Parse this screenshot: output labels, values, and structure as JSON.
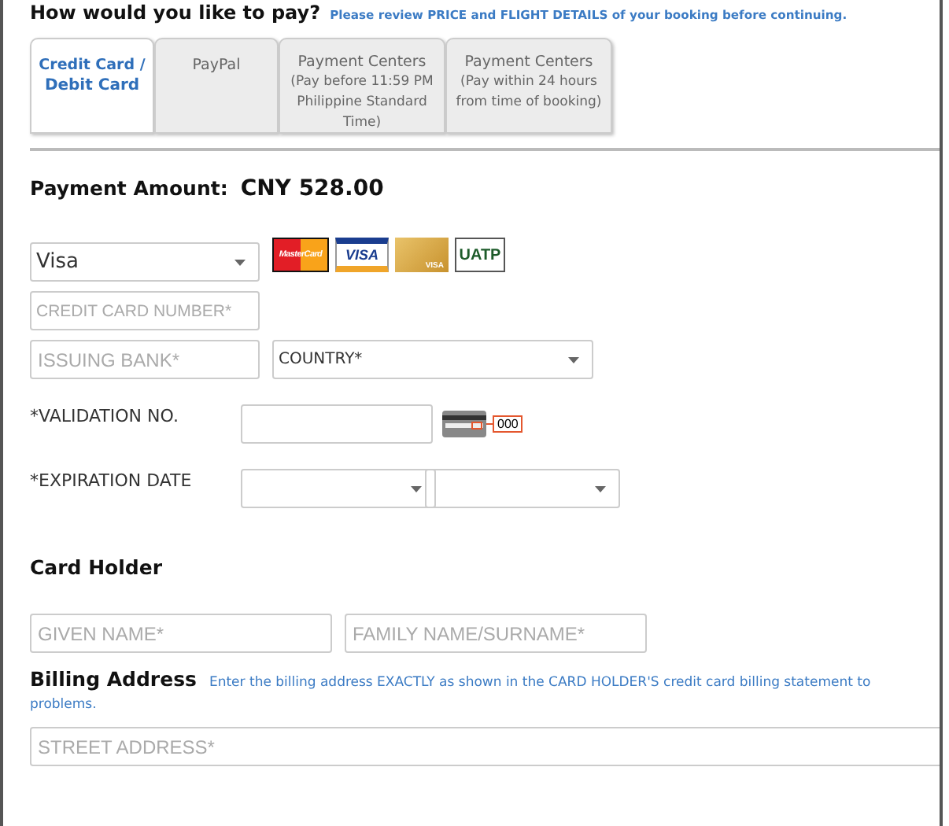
{
  "header": {
    "title": "How would you like to pay?",
    "note": "Please review PRICE and FLIGHT DETAILS of your booking before continuing."
  },
  "tabs": [
    {
      "lines": [
        "Credit Card /",
        "Debit Card"
      ],
      "selected": true
    },
    {
      "lines": [
        "PayPal"
      ],
      "selected": false
    },
    {
      "lines": [
        "Payment Centers",
        "(Pay before 11:59 PM",
        "Philippine Standard",
        "Time)"
      ],
      "selected": false
    },
    {
      "lines": [
        "Payment Centers",
        "(Pay within 24 hours",
        "from time of booking)"
      ],
      "selected": false
    }
  ],
  "payment_amount": {
    "label": "Payment Amount:",
    "value": "CNY 528.00"
  },
  "card_type": {
    "value": "Visa"
  },
  "card_logos": [
    {
      "kind": "mastercard",
      "label": "MasterCard"
    },
    {
      "kind": "visa",
      "label": "VISA"
    },
    {
      "kind": "gold",
      "label": "VISA"
    },
    {
      "kind": "uatp",
      "label": "UATP"
    }
  ],
  "card_number": {
    "placeholder": "CREDIT CARD NUMBER*"
  },
  "issuing_bank": {
    "placeholder": "ISSUING BANK*"
  },
  "country": {
    "placeholder": "COUNTRY*"
  },
  "validation": {
    "label": "*VALIDATION NO.",
    "hint": "000"
  },
  "expiration": {
    "label": "*EXPIRATION DATE"
  },
  "card_holder": {
    "title": "Card Holder",
    "given_name": {
      "placeholder": "GIVEN NAME*"
    },
    "family_name": {
      "placeholder": "FAMILY NAME/SURNAME*"
    }
  },
  "billing": {
    "title": "Billing Address",
    "note_lines": [
      "Enter the billing address EXACTLY as shown in the CARD HOLDER'S credit card billing statement to",
      "problems."
    ],
    "street": {
      "placeholder": "STREET ADDRESS*"
    }
  }
}
